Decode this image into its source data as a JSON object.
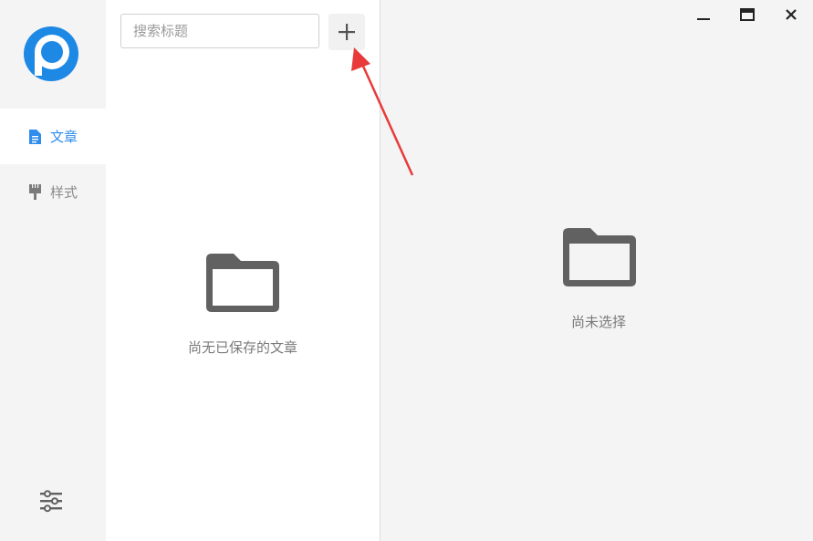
{
  "nav": {
    "items": [
      {
        "label": "文章",
        "icon": "document-icon",
        "active": true
      },
      {
        "label": "样式",
        "icon": "brush-icon",
        "active": false
      }
    ],
    "settings_icon": "sliders-icon"
  },
  "list": {
    "search_placeholder": "搜索标题",
    "add_icon": "plus-icon",
    "empty_text": "尚无已保存的文章"
  },
  "detail": {
    "empty_text": "尚未选择"
  },
  "colors": {
    "accent": "#2e8ded",
    "logo_blue": "#1e88e5",
    "folder": "#616161",
    "annotation_arrow": "#e83a3a"
  }
}
